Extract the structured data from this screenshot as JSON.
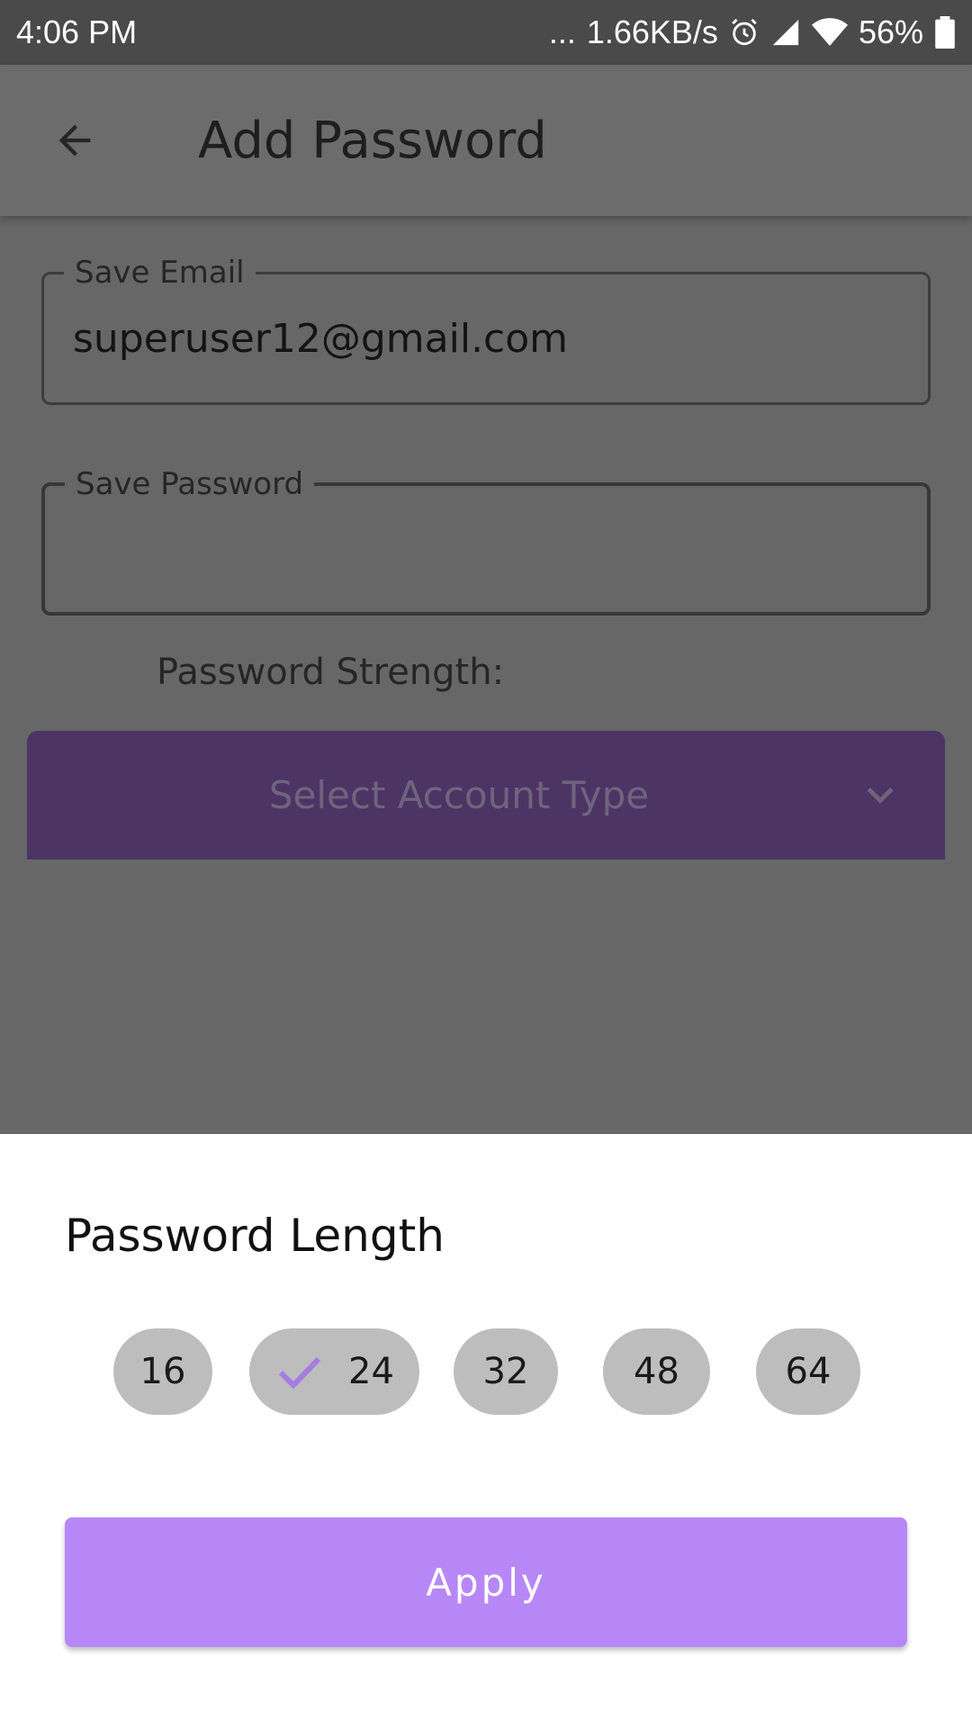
{
  "status_bar": {
    "time": "4:06 PM",
    "dots": "...",
    "network_speed": "1.66KB/s",
    "battery": "56%",
    "icons": [
      "alarm-icon",
      "cell-signal-icon",
      "wifi-icon",
      "battery-icon"
    ]
  },
  "app_bar": {
    "title": "Add Password",
    "back_icon": "arrow-left-icon"
  },
  "form": {
    "email": {
      "label": "Save Email",
      "value": "superuser12@gmail.com"
    },
    "password": {
      "label": "Save Password",
      "value": ""
    },
    "strength_label": "Password Strength:",
    "account_type": {
      "placeholder": "Select Account Type",
      "icon": "chevron-down-icon"
    }
  },
  "sheet": {
    "title": "Password Length",
    "options": [
      "16",
      "24",
      "32",
      "48",
      "64"
    ],
    "selected": "24",
    "apply_label": "Apply"
  },
  "colors": {
    "accent": "#b887f7",
    "check": "#a47de0",
    "account_type_bg": "#4c3565",
    "chip": "#bdbdbd",
    "scrim": "#676767"
  }
}
